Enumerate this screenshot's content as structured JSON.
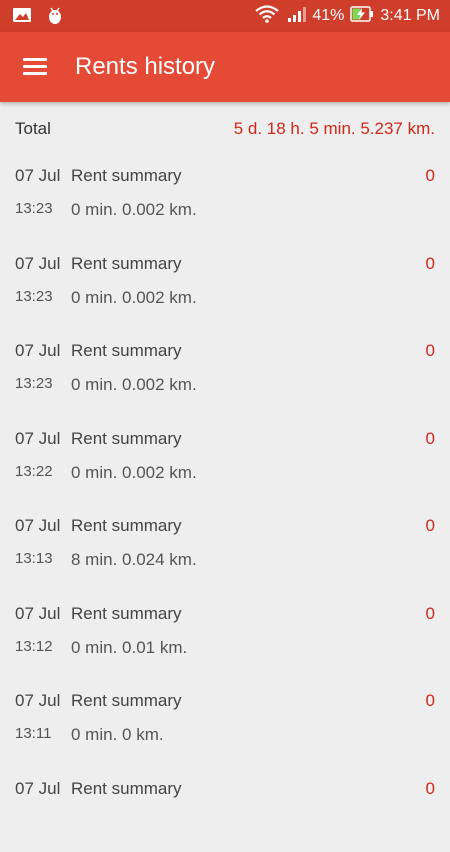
{
  "status_bar": {
    "icons": [
      "gallery-icon",
      "android-debug-icon",
      "wifi-icon",
      "cell-signal-icon",
      "battery-charging-icon"
    ],
    "battery": "41%",
    "time": "3:41 PM"
  },
  "app_bar": {
    "title": "Rents history",
    "menu_icon": "hamburger-menu-icon"
  },
  "total": {
    "label": "Total",
    "value": "5 d. 18 h. 5 min. 5.237 km."
  },
  "rents": [
    {
      "date": "07 Jul",
      "title": "Rent summary",
      "amount": "0",
      "time": "13:23",
      "details": "0 min. 0.002 km."
    },
    {
      "date": "07 Jul",
      "title": "Rent summary",
      "amount": "0",
      "time": "13:23",
      "details": "0 min. 0.002 km."
    },
    {
      "date": "07 Jul",
      "title": "Rent summary",
      "amount": "0",
      "time": "13:23",
      "details": "0 min. 0.002 km."
    },
    {
      "date": "07 Jul",
      "title": "Rent summary",
      "amount": "0",
      "time": "13:22",
      "details": "0 min. 0.002 km."
    },
    {
      "date": "07 Jul",
      "title": "Rent summary",
      "amount": "0",
      "time": "13:13",
      "details": "8 min. 0.024 km."
    },
    {
      "date": "07 Jul",
      "title": "Rent summary",
      "amount": "0",
      "time": "13:12",
      "details": "0 min. 0.01 km."
    },
    {
      "date": "07 Jul",
      "title": "Rent summary",
      "amount": "0",
      "time": "13:11",
      "details": "0 min. 0 km."
    },
    {
      "date": "07 Jul",
      "title": "Rent summary",
      "amount": "0",
      "time": "",
      "details": ""
    }
  ],
  "colors": {
    "status_bar": "#cf3e2b",
    "app_bar": "#e44a35",
    "accent": "#d0281a",
    "background": "#eeeeee"
  }
}
